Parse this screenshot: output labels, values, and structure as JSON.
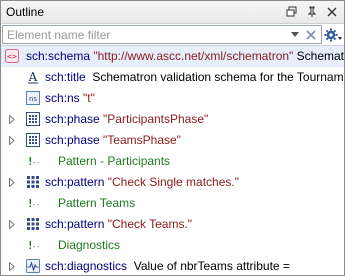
{
  "title": "Outline",
  "filter": {
    "placeholder": "Element name filter",
    "value": ""
  },
  "rows": [
    {
      "name": "sch:schema",
      "attr": "\"http://www.ascc.net/xml/schematron\"",
      "text": "Schematron"
    },
    {
      "name": "sch:title",
      "text": "Schematron validation schema for the Tournament"
    },
    {
      "name": "sch:ns",
      "attr": "\"t\""
    },
    {
      "name": "sch:phase",
      "attr": "\"ParticipantsPhase\""
    },
    {
      "name": "sch:phase",
      "attr": "\"TeamsPhase\""
    },
    {
      "comment": "Pattern - Participants"
    },
    {
      "name": "sch:pattern",
      "attr": "\"Check Single matches.\""
    },
    {
      "comment": "Pattern Teams"
    },
    {
      "name": "sch:pattern",
      "attr": "\"Check Teams.\""
    },
    {
      "comment": "Diagnostics"
    },
    {
      "name": "sch:diagnostics",
      "text": "Value of nbrTeams attribute ="
    }
  ],
  "icons": {
    "schema": "schema-icon",
    "title": "title-icon",
    "ns": "namespace-icon",
    "phase": "phase-icon",
    "comment": "comment-icon",
    "pattern": "pattern-icon",
    "diagnostics": "diagnostics-icon"
  },
  "colors": {
    "element": "#000080",
    "attribute": "#8b1a1a",
    "comment": "#1f7a1f",
    "selection": "#e6eefb"
  }
}
